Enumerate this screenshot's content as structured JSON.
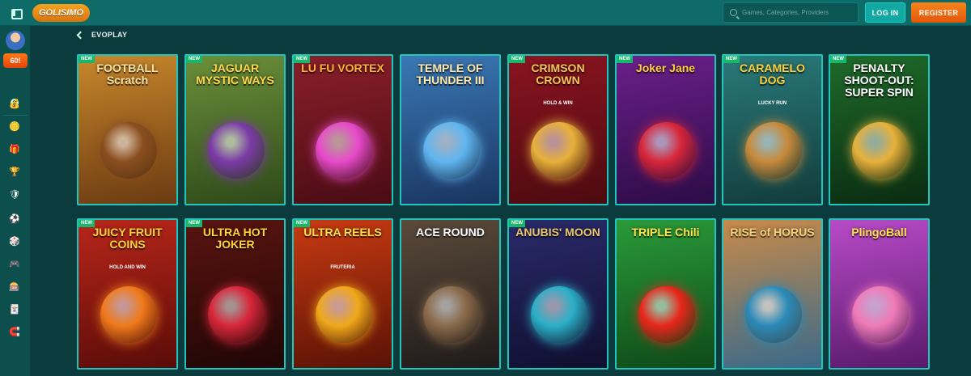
{
  "header": {
    "logo_text": "GOLISIMO",
    "search_placeholder": "Games, Categories, Providers",
    "login_label": "LOG IN",
    "register_label": "REGISTER"
  },
  "sidebar": {
    "promo_badge": "60!",
    "help_label": "?",
    "items": [
      {
        "icon": "money-bag-icon",
        "glyph": "💰"
      },
      {
        "icon": "coin-icon",
        "glyph": "🪙"
      },
      {
        "icon": "gift-icon",
        "glyph": "🎁"
      },
      {
        "icon": "trophy-icon",
        "glyph": "🏆"
      },
      {
        "icon": "shield-icon",
        "glyph": "🛡"
      },
      {
        "icon": "soccer-ball-icon",
        "glyph": "⚽"
      },
      {
        "icon": "live-casino-icon",
        "glyph": "🎲"
      },
      {
        "icon": "gamepad-icon",
        "glyph": "🎮"
      },
      {
        "icon": "slot-machine-icon",
        "glyph": "🎰"
      },
      {
        "icon": "cards-icon",
        "glyph": "🃏"
      },
      {
        "icon": "horseshoe-icon",
        "glyph": "🧲"
      }
    ]
  },
  "breadcrumb": {
    "label": "EVOPLAY"
  },
  "games": [
    {
      "title": "FOOTBALL Scratch",
      "sub": "",
      "badge": "NEW",
      "bg": "#c8872c",
      "bg2": "#6b3b12",
      "title_color": "#f7e2a4",
      "accent": "#8a4e1e"
    },
    {
      "title": "JAGUAR MYSTIC WAYS",
      "sub": "",
      "badge": "NEW",
      "bg": "#6b8f3a",
      "bg2": "#2f4a1a",
      "title_color": "#ffd84a",
      "accent": "#7b3aa8"
    },
    {
      "title": "LU FU VORTEX",
      "sub": "",
      "badge": "NEW",
      "bg": "#8a1f2a",
      "bg2": "#4a0c14",
      "title_color": "#ffb23a",
      "accent": "#e84acb"
    },
    {
      "title": "TEMPLE OF THUNDER III",
      "sub": "",
      "badge": "",
      "bg": "#3a78b5",
      "bg2": "#1a3560",
      "title_color": "#ffe9a8",
      "accent": "#5fb6f0"
    },
    {
      "title": "CRIMSON CROWN",
      "sub": "HOLD & WIN",
      "badge": "NEW",
      "bg": "#8a1420",
      "bg2": "#4d0a10",
      "title_color": "#f5c65a",
      "accent": "#e8b13a"
    },
    {
      "title": "Joker Jane",
      "sub": "",
      "badge": "NEW",
      "bg": "#6b1f8a",
      "bg2": "#2c0c46",
      "title_color": "#ffd23a",
      "accent": "#d8263a"
    },
    {
      "title": "CARAMELO DOG",
      "sub": "LUCKY RUN",
      "badge": "NEW",
      "bg": "#2a7a7a",
      "bg2": "#123c3c",
      "title_color": "#ffd23a",
      "accent": "#c88a3a"
    },
    {
      "title": "PENALTY SHOOT-OUT: SUPER SPIN",
      "sub": "",
      "badge": "NEW",
      "bg": "#1f6a2a",
      "bg2": "#0a2c12",
      "title_color": "#ffffff",
      "accent": "#e8b13a"
    },
    {
      "title": "JUICY FRUIT COINS",
      "sub": "HOLD AND WIN",
      "badge": "NEW",
      "bg": "#b8261a",
      "bg2": "#5a0c08",
      "title_color": "#ffd23a",
      "accent": "#f07a1a"
    },
    {
      "title": "ULTRA HOT JOKER",
      "sub": "",
      "badge": "NEW",
      "bg": "#5a1410",
      "bg2": "#1f0606",
      "title_color": "#ffd23a",
      "accent": "#d8263a"
    },
    {
      "title": "ULTRA REELS",
      "sub": "FRUTERIA",
      "badge": "NEW",
      "bg": "#c83a12",
      "bg2": "#5a1206",
      "title_color": "#ffe14a",
      "accent": "#f0a81a"
    },
    {
      "title": "ACE ROUND",
      "sub": "",
      "badge": "",
      "bg": "#5a4a3a",
      "bg2": "#1f1a1a",
      "title_color": "#ffffff",
      "accent": "#8a6a4a"
    },
    {
      "title": "ANUBIS' MOON",
      "sub": "",
      "badge": "NEW",
      "bg": "#2a2a6a",
      "bg2": "#100f30",
      "title_color": "#e8c86a",
      "accent": "#2ab0c8"
    },
    {
      "title": "TRIPLE Chili",
      "sub": "",
      "badge": "",
      "bg": "#2a9a3a",
      "bg2": "#0f4a18",
      "title_color": "#ffe14a",
      "accent": "#e8261a"
    },
    {
      "title": "RISE of HORUS",
      "sub": "",
      "badge": "",
      "bg": "#c88a4a",
      "bg2": "#3a6a8a",
      "title_color": "#f5d27a",
      "accent": "#2a8ab8"
    },
    {
      "title": "PlingoBall",
      "sub": "",
      "badge": "",
      "bg": "#b84ac8",
      "bg2": "#5a1a6a",
      "title_color": "#ffe14a",
      "accent": "#f07ab8"
    }
  ]
}
